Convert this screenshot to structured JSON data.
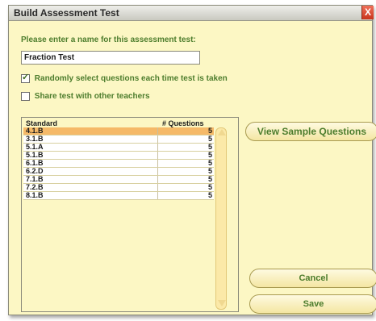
{
  "window": {
    "title": "Build Assessment Test",
    "close_glyph": "X"
  },
  "form": {
    "name_prompt": "Please enter a name for this assessment test:",
    "name_value": "Fraction Test",
    "random_label": "Randomly select questions each time test is taken",
    "random_checked": true,
    "share_label": "Share test with other teachers",
    "share_checked": false
  },
  "table": {
    "col_standard": "Standard",
    "col_questions": "# Questions",
    "rows": [
      {
        "standard": "4.1.B",
        "questions": "5",
        "selected": true
      },
      {
        "standard": "3.1.B",
        "questions": "5"
      },
      {
        "standard": "5.1.A",
        "questions": "5"
      },
      {
        "standard": "5.1.B",
        "questions": "5"
      },
      {
        "standard": "6.1.B",
        "questions": "5"
      },
      {
        "standard": "6.2.D",
        "questions": "5"
      },
      {
        "standard": "7.1.B",
        "questions": "5"
      },
      {
        "standard": "7.2.B",
        "questions": "5"
      },
      {
        "standard": "8.1.B",
        "questions": "5"
      }
    ]
  },
  "buttons": {
    "view_sample": "View Sample Questions",
    "cancel": "Cancel",
    "save": "Save"
  },
  "colors": {
    "panel_bg": "#fcf7c4",
    "label_green": "#4d7d2d",
    "selected_row": "#f5b968",
    "close_red": "#c8341c"
  }
}
